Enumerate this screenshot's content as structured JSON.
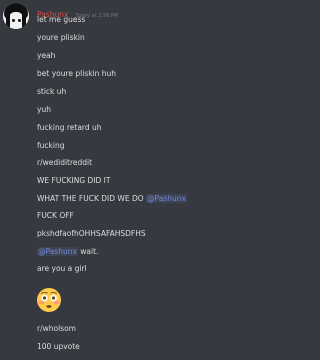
{
  "author": {
    "username": "Pashunx",
    "timestamp": "Today at 2:56 PM",
    "avatar_icon": "anime-girl-avatar"
  },
  "lines": [
    {
      "text": "let me guess"
    },
    {
      "text": "youre pliskin"
    },
    {
      "text": "yeah"
    },
    {
      "text": "bet youre pliskin huh"
    },
    {
      "text": "stick uh"
    },
    {
      "text": "yuh"
    },
    {
      "text": "fucking retard uh"
    },
    {
      "text": "fucking"
    },
    {
      "text": "r/wediditreddit"
    },
    {
      "text": "WE FUCKING DID IT"
    },
    {
      "text": "WHAT THE FUCK DID WE DO ",
      "mention": "@Pashunx"
    },
    {
      "text": "FUCK OFF"
    },
    {
      "text": "pkshdfaofhOHHSAFAHSDFHS"
    },
    {
      "mention": "@Pashunx",
      "text": " wait."
    },
    {
      "text": "are you a girl"
    },
    {
      "text": "r/wholsom"
    },
    {
      "text": "100 upvote"
    }
  ],
  "emoji": {
    "name": "flushed-face-emoji",
    "color": "#ffcb4c"
  },
  "colors": {
    "background": "#36393f",
    "username": "#e14f4f",
    "text": "#dcddde",
    "mention": "#7289da",
    "timestamp": "#72767d"
  }
}
